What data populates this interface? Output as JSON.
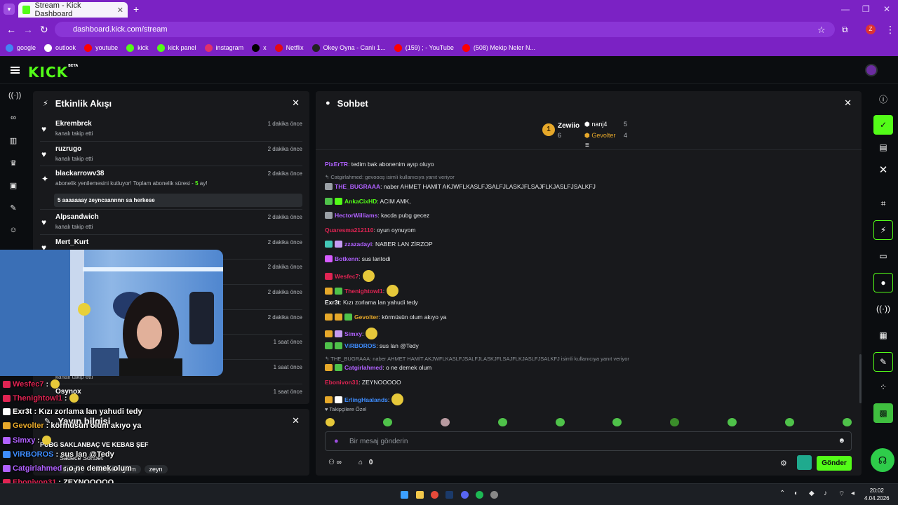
{
  "browser": {
    "tab_title": "Stream - Kick Dashboard",
    "tab_close": "✕",
    "new_tab": "+",
    "url": "dashboard.kick.com/stream",
    "profile": "Z",
    "bookmarks": [
      {
        "label": "google",
        "color": "#4285f4"
      },
      {
        "label": "outlook",
        "color": "#ffffff"
      },
      {
        "label": "youtube",
        "color": "#ff0000"
      },
      {
        "label": "kick",
        "color": "#53fc18"
      },
      {
        "label": "kick panel",
        "color": "#53fc18"
      },
      {
        "label": "instagram",
        "color": "#e1306c"
      },
      {
        "label": "x",
        "color": "#000000"
      },
      {
        "label": "Netflix",
        "color": "#e50914"
      },
      {
        "label": "Okey Oyna - Canlı 1...",
        "color": "#222222"
      },
      {
        "label": "(159) ; - YouTube",
        "color": "#ff0000"
      },
      {
        "label": "(508) Mekip Neler N...",
        "color": "#ff0000"
      }
    ]
  },
  "logo": {
    "text": "KICK",
    "badge": "BETA"
  },
  "activity": {
    "title": "Etkinlik Akışı",
    "close": "✕",
    "items": [
      {
        "name": "Ekrembrck",
        "sub": "kanalı takip etti",
        "time": "1 dakika önce",
        "icon": "heart"
      },
      {
        "name": "ruzrugo",
        "sub": "kanalı takip etti",
        "time": "2 dakika önce",
        "icon": "heart"
      },
      {
        "name": "blackarrowv38",
        "sub": "abonelik yenilemesini kutluyor! Toplam abonelik süresi -",
        "months": "5",
        "suffix": "ay!",
        "time": "2 dakika önce",
        "message": "5 aaaaaaay zeyncaannnn sa herkese",
        "icon": "sub"
      },
      {
        "name": "Alpsandwich",
        "sub": "kanalı takip etti",
        "time": "2 dakika önce",
        "icon": "heart"
      },
      {
        "name": "Mert_Kurt",
        "sub": "",
        "time": "2 dakika önce",
        "icon": "heart"
      },
      {
        "name": "",
        "sub": "",
        "time": "2 dakika önce",
        "icon": ""
      },
      {
        "name": "",
        "sub": "",
        "time": "2 dakika önce",
        "icon": ""
      },
      {
        "name": "",
        "sub": "",
        "time": "2 dakika önce",
        "icon": ""
      },
      {
        "name": "",
        "sub": "",
        "time": "1 saat önce",
        "icon": ""
      },
      {
        "name": "",
        "sub": "kanalı takip etti",
        "time": "1 saat önce",
        "icon": ""
      },
      {
        "name": "Osynox",
        "sub": "",
        "time": "1 saat önce",
        "icon": ""
      }
    ]
  },
  "chat": {
    "title": "Sohbet",
    "close": "✕",
    "leaderboard": [
      {
        "rank": "1",
        "name": "Zewiio",
        "value": "6"
      },
      {
        "name": "nanj4",
        "value": "5"
      },
      {
        "name": "Gevolter",
        "value": "4"
      }
    ],
    "messages": [
      {
        "user": "PixErTR",
        "color": "#b061ff",
        "text": ": tedim bak abonenim ayıp oluyo",
        "badges": []
      },
      {
        "reply": "Catgirlahmed: gevoooş isimli kullanıcıya yanıt veriyor"
      },
      {
        "user": "THE_BUGRAAA",
        "color": "#b061ff",
        "text": ": naber AHMET HAMİT AKJWFLKASLFJSALFJLASKJFLSAJFLKJASLFJSALKFJ",
        "badges": [
          "#9aa0a6"
        ]
      },
      {
        "user": "AnkaCixHD",
        "color": "#53fc18",
        "text": ": ACIM AMK,",
        "badges": [
          "#4fc24a",
          "#53fc18"
        ]
      },
      {
        "user": "HectorWilliams",
        "color": "#b061ff",
        "text": ": kacda pubg gecez",
        "badges": [
          "#9aa0a6"
        ]
      },
      {
        "user": "Quaresma212110",
        "color": "#e02453",
        "text": ": oyun oynuyom",
        "badges": []
      },
      {
        "user": "zzazadayi",
        "color": "#b061ff",
        "text": ": NABER LAN ZİRZOP",
        "badges": [
          "#43c7b7",
          "#c59bf2"
        ]
      },
      {
        "user": "Botkenn",
        "color": "#b061ff",
        "text": ": sus lantodi",
        "badges": [
          "#d65cff"
        ]
      },
      {
        "user": "Wesfec7",
        "color": "#e02453",
        "text": ":",
        "badges": [
          "#e02453"
        ],
        "emote": true
      },
      {
        "user": "Thenightowl1",
        "color": "#e02453",
        "text": ":",
        "badges": [
          "#e6a82a",
          "#4fc24a"
        ],
        "emote": true
      },
      {
        "user": "Exr3t",
        "color": "#ffffff",
        "text": ": Kızı zorlama lan yahudi tedy",
        "badges": []
      },
      {
        "user": "Gevolter",
        "color": "#e6a82a",
        "text": ": körmüsün olum akıyo ya",
        "badges": [
          "#e6a82a",
          "#e6a82a",
          "#4fc24a"
        ]
      },
      {
        "user": "Simxy",
        "color": "#b061ff",
        "text": ":",
        "badges": [
          "#e6a82a",
          "#c59bf2"
        ],
        "emote": true
      },
      {
        "user": "ViRBOROS",
        "color": "#3e8dff",
        "text": ": sus lan @Tedy",
        "badges": [
          "#4fc24a",
          "#4fc24a"
        ]
      },
      {
        "reply": "THE_BUGRAAA: naber AHMET HAMİT AKJWFLKASLFJSALFJLASKJFLSAJFLKJASLFJSALKFJ isimli kullanıcıya yanıt veriyor"
      },
      {
        "user": "Catgirlahmed",
        "color": "#b061ff",
        "text": ": o ne demek olum",
        "badges": [
          "#e6a82a",
          "#4fc24a"
        ]
      },
      {
        "user": "Ebonivon31",
        "color": "#e02453",
        "text": ": ZEYNOOOOO",
        "badges": []
      },
      {
        "user": "ErlingHaalands",
        "color": "#3e8dff",
        "text": ":",
        "badges": [
          "#e6a82a",
          "#ffffff"
        ],
        "emote": true
      }
    ],
    "followers_only": "Takipçilere Özel",
    "input_placeholder": "Bir mesaj gönderin",
    "users_count": "∞",
    "gift_count": "0",
    "send_label": "Gönder"
  },
  "stream_info": {
    "title": "Yayın bilgisi",
    "close": "✕",
    "stream_title": "PUBG SAKLANBAÇ VE KEBAB ŞEF",
    "chat_mode": "Sadece Sohbet",
    "tags": [
      "türkçe",
      "makışıklıoğlum",
      "zeyn"
    ]
  },
  "overlay_chat": [
    {
      "user": "Wesfec7",
      "color": "#e02453",
      "text": ":",
      "emote": true
    },
    {
      "user": "Thenightowl1",
      "color": "#e02453",
      "text": ":",
      "emote": true
    },
    {
      "user": "Exr3t",
      "color": "#ffffff",
      "text": ": Kızı zorlama lan yahudi tedy"
    },
    {
      "user": "Gevolter",
      "color": "#e6a82a",
      "text": ": körmüsün olum akıyo ya"
    },
    {
      "user": "Simxy",
      "color": "#b061ff",
      "text": ":",
      "emote": true
    },
    {
      "user": "ViRBOROS",
      "color": "#3e8dff",
      "text": ": sus lan @Tedy"
    },
    {
      "user": "Catgirlahmed",
      "color": "#b061ff",
      "text": ": o ne demek olum"
    },
    {
      "user": "Ebonivon31",
      "color": "#e02453",
      "text": ": ZEYNOOOOO"
    },
    {
      "user": "ErlingHaalands",
      "color": "#3e8dff",
      "text": ":",
      "emote": true
    }
  ],
  "taskbar": {
    "time": "20:02",
    "date": "4.04.2026"
  }
}
